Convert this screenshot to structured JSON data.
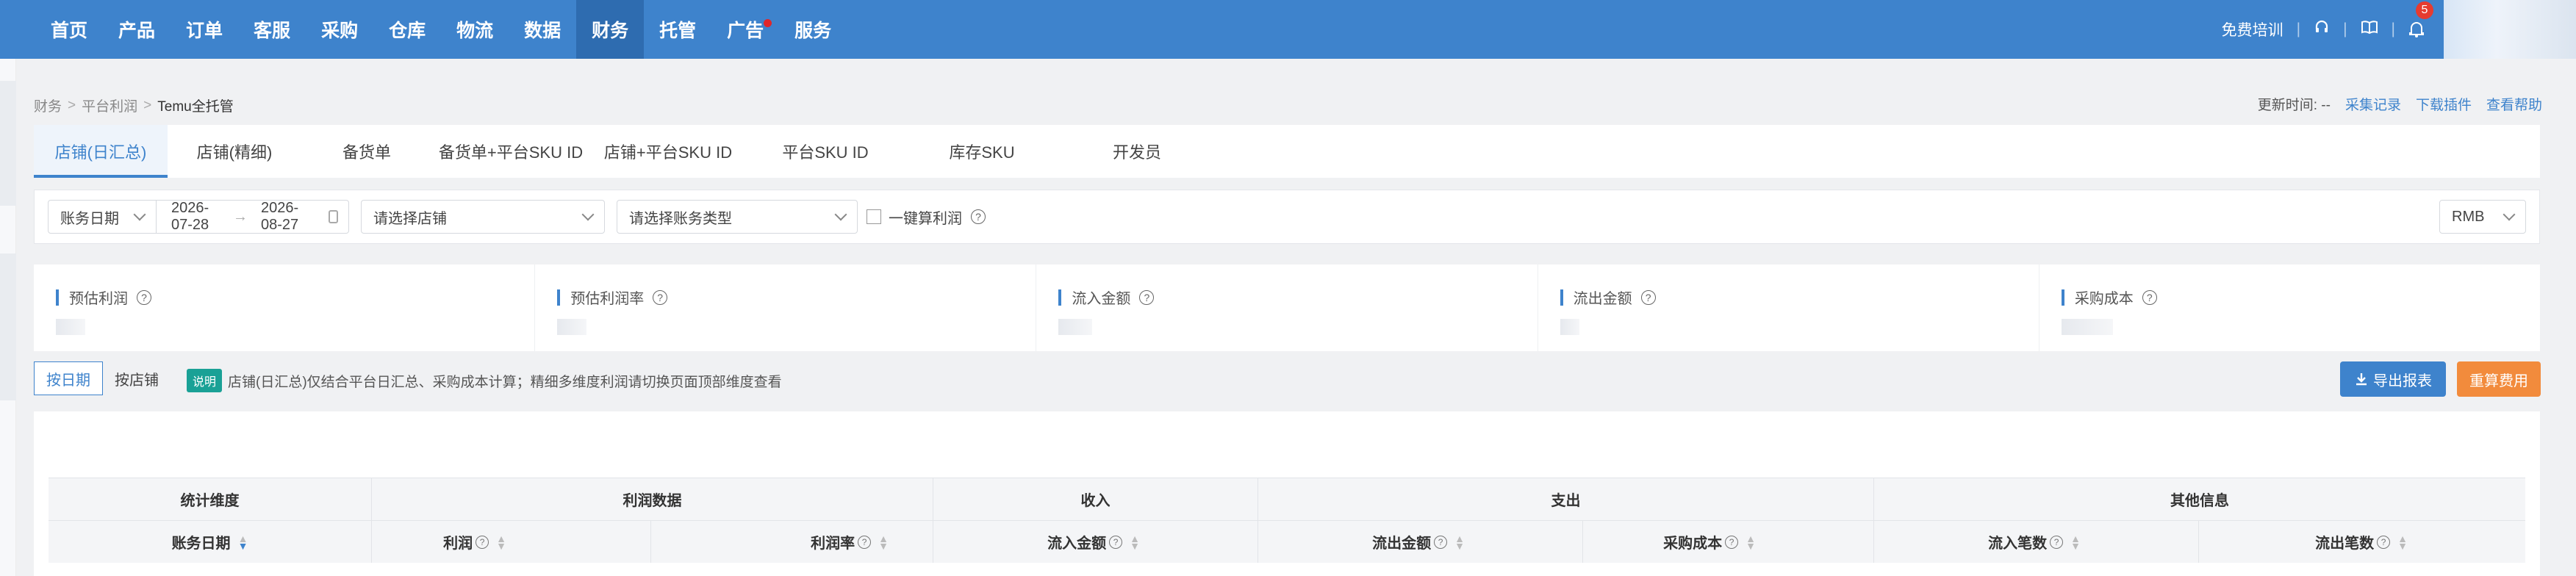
{
  "nav": {
    "items": [
      {
        "label": "首页"
      },
      {
        "label": "产品"
      },
      {
        "label": "订单"
      },
      {
        "label": "客服"
      },
      {
        "label": "采购"
      },
      {
        "label": "仓库"
      },
      {
        "label": "物流"
      },
      {
        "label": "数据"
      },
      {
        "label": "财务"
      },
      {
        "label": "托管"
      },
      {
        "label": "广告"
      },
      {
        "label": "服务"
      }
    ],
    "active": "财务",
    "free_training": "免费培训",
    "notification_count": "5"
  },
  "breadcrumb": {
    "items": [
      "财务",
      "平台利润",
      "Temu全托管"
    ]
  },
  "header": {
    "update_time_label": "更新时间:",
    "update_time_value": "--",
    "link_collect": "采集记录",
    "link_download": "下载插件",
    "link_help": "查看帮助"
  },
  "tabs": [
    {
      "label": "店铺(日汇总)"
    },
    {
      "label": "店铺(精细)"
    },
    {
      "label": "备货单"
    },
    {
      "label": "备货单+平台SKU ID"
    },
    {
      "label": "店铺+平台SKU ID"
    },
    {
      "label": "平台SKU ID"
    },
    {
      "label": "库存SKU"
    },
    {
      "label": "开发员"
    }
  ],
  "filters": {
    "date_type": "账务日期",
    "start_date": "2026-07-28",
    "end_date": "2026-08-27",
    "store_placeholder": "请选择店铺",
    "account_type_placeholder": "请选择账务类型",
    "calc_profit_label": "一键算利润",
    "currency": "RMB"
  },
  "summary_cards": [
    {
      "title": "预估利润"
    },
    {
      "title": "预估利润率"
    },
    {
      "title": "流入金额"
    },
    {
      "title": "流出金额"
    },
    {
      "title": "采购成本"
    }
  ],
  "view_toggle": {
    "by_date": "按日期",
    "by_store": "按店铺"
  },
  "note": {
    "tag": "说明",
    "text": "店铺(日汇总)仅结合平台日汇总、采购成本计算；精细多维度利润请切换页面顶部维度查看"
  },
  "buttons": {
    "export": "导出报表",
    "recalc": "重算费用"
  },
  "table": {
    "groups": [
      {
        "label": "统计维度"
      },
      {
        "label": "利润数据"
      },
      {
        "label": "收入"
      },
      {
        "label": "支出"
      },
      {
        "label": "其他信息"
      }
    ],
    "columns": [
      {
        "label": "账务日期"
      },
      {
        "label": "利润"
      },
      {
        "label": "利润率"
      },
      {
        "label": "流入金额"
      },
      {
        "label": "流出金额"
      },
      {
        "label": "采购成本"
      },
      {
        "label": "流入笔数"
      },
      {
        "label": "流出笔数"
      }
    ]
  },
  "colors": {
    "primary": "#3e83cc",
    "orange": "#f28b3c",
    "teal": "#1aa196"
  }
}
